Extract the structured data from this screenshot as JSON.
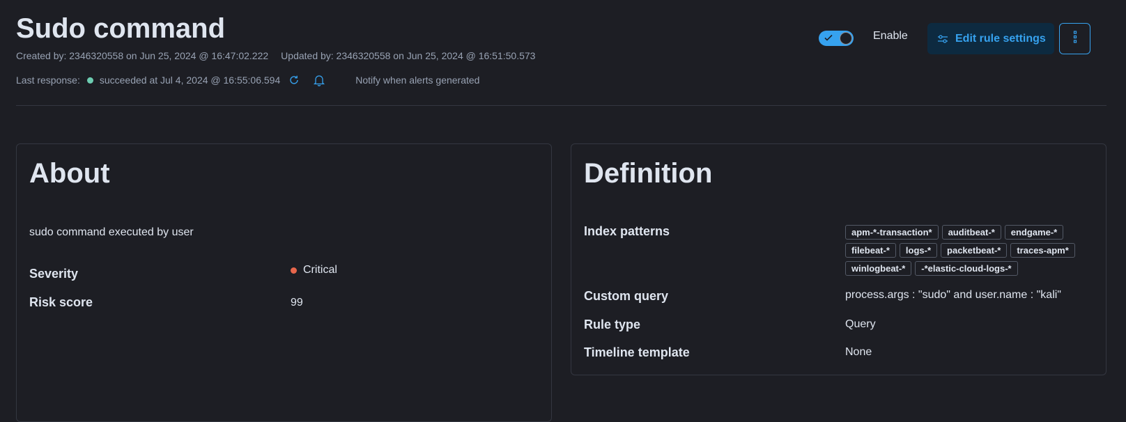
{
  "header": {
    "title": "Sudo command",
    "created": "Created by: 2346320558 on Jun 25, 2024 @ 16:47:02.222",
    "updated": "Updated by: 2346320558 on Jun 25, 2024 @ 16:51:50.573",
    "last_response_label": "Last response:",
    "last_response_status": "succeeded at Jul 4, 2024 @ 16:55:06.594",
    "notify_label": "Notify when alerts generated",
    "enable_label": "Enable",
    "enabled": true,
    "edit_button": "Edit rule settings",
    "icons": {
      "status": "status-dot",
      "refresh": "refresh-icon",
      "notify": "bell-icon",
      "edit": "sliders-icon",
      "more": "more-vertical-icon"
    }
  },
  "about": {
    "title": "About",
    "description": "sudo command executed by user",
    "severity_label": "Severity",
    "severity_value": "Critical",
    "risk_label": "Risk score",
    "risk_value": "99"
  },
  "definition": {
    "title": "Definition",
    "index_label": "Index patterns",
    "index_patterns": [
      "apm-*-transaction*",
      "auditbeat-*",
      "endgame-*",
      "filebeat-*",
      "logs-*",
      "packetbeat-*",
      "traces-apm*",
      "winlogbeat-*",
      "-*elastic-cloud-logs-*"
    ],
    "query_label": "Custom query",
    "query_value": "process.args : \"sudo\"  and user.name : \"kali\"",
    "rule_type_label": "Rule type",
    "rule_type_value": "Query",
    "timeline_label": "Timeline template",
    "timeline_value": "None"
  },
  "colors": {
    "accent": "#36a2ef",
    "button_bg": "#0d2a40",
    "success": "#6dccb1",
    "critical": "#e7664c"
  }
}
